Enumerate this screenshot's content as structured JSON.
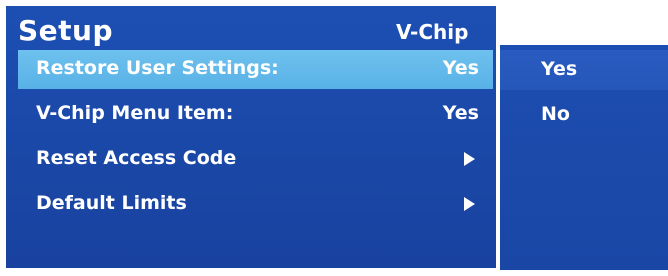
{
  "header": {
    "title": "Setup",
    "context": "V-Chip"
  },
  "menu": {
    "items": [
      {
        "label": "Restore User Settings:",
        "value": "Yes"
      },
      {
        "label": "V-Chip Menu Item:",
        "value": "Yes"
      },
      {
        "label": "Reset Access Code",
        "value": ""
      },
      {
        "label": "Default Limits",
        "value": ""
      }
    ]
  },
  "options": {
    "items": [
      {
        "label": "Yes"
      },
      {
        "label": "No"
      }
    ]
  },
  "colors": {
    "panel": "#1a47a6",
    "highlight": "#5fb6e8",
    "text": "#ffffff"
  }
}
